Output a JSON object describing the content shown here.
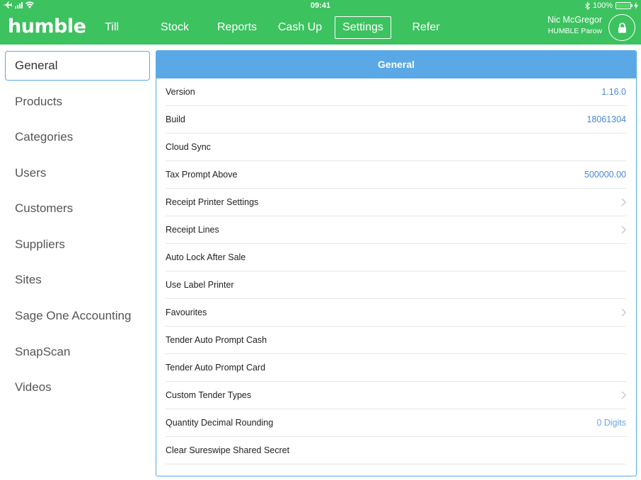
{
  "status_bar": {
    "time": "09:41",
    "battery": "100%",
    "icons": [
      "airplane-icon",
      "signal-icon",
      "wifi-icon",
      "bluetooth-icon",
      "battery-icon",
      "charging-icon"
    ]
  },
  "header": {
    "logo": "humble",
    "nav": [
      {
        "label": "Till"
      },
      {
        "label": "Stock"
      },
      {
        "label": "Reports"
      },
      {
        "label": "Cash Up"
      },
      {
        "label": "Settings"
      },
      {
        "label": "Refer"
      }
    ],
    "active_nav": "Settings",
    "user": {
      "name": "Nic McGregor",
      "site": "HUMBLE Parow"
    },
    "lock_icon": "lock-icon"
  },
  "sidebar": {
    "items": [
      {
        "label": "General"
      },
      {
        "label": "Products"
      },
      {
        "label": "Categories"
      },
      {
        "label": "Users"
      },
      {
        "label": "Customers"
      },
      {
        "label": "Suppliers"
      },
      {
        "label": "Sites"
      },
      {
        "label": "Sage One Accounting"
      },
      {
        "label": "SnapScan"
      },
      {
        "label": "Videos"
      }
    ],
    "selected": "General"
  },
  "panel": {
    "title": "General",
    "rows": [
      {
        "label": "Version",
        "value": "1.16.0"
      },
      {
        "label": "Build",
        "value": "18061304"
      },
      {
        "label": "Cloud Sync",
        "value": ""
      },
      {
        "label": "Tax Prompt Above",
        "value": "500000.00"
      },
      {
        "label": "Receipt Printer Settings",
        "value": "",
        "chevron": true
      },
      {
        "label": "Receipt Lines",
        "value": "",
        "chevron": true
      },
      {
        "label": "Auto Lock After Sale",
        "value": ""
      },
      {
        "label": "Use Label Printer",
        "value": ""
      },
      {
        "label": "Favourites",
        "value": "",
        "chevron": true
      },
      {
        "label": "Tender Auto Prompt Cash",
        "value": ""
      },
      {
        "label": "Tender Auto Prompt Card",
        "value": ""
      },
      {
        "label": "Custom Tender Types",
        "value": "",
        "chevron": true
      },
      {
        "label": "Quantity Decimal Rounding",
        "value": "0 Digits"
      },
      {
        "label": "Clear Sureswipe Shared Secret",
        "value": ""
      }
    ]
  },
  "colors": {
    "header_bg": "#3cc25f",
    "accent_blue": "#5aa9e6",
    "value_blue": "#4a86d8"
  }
}
